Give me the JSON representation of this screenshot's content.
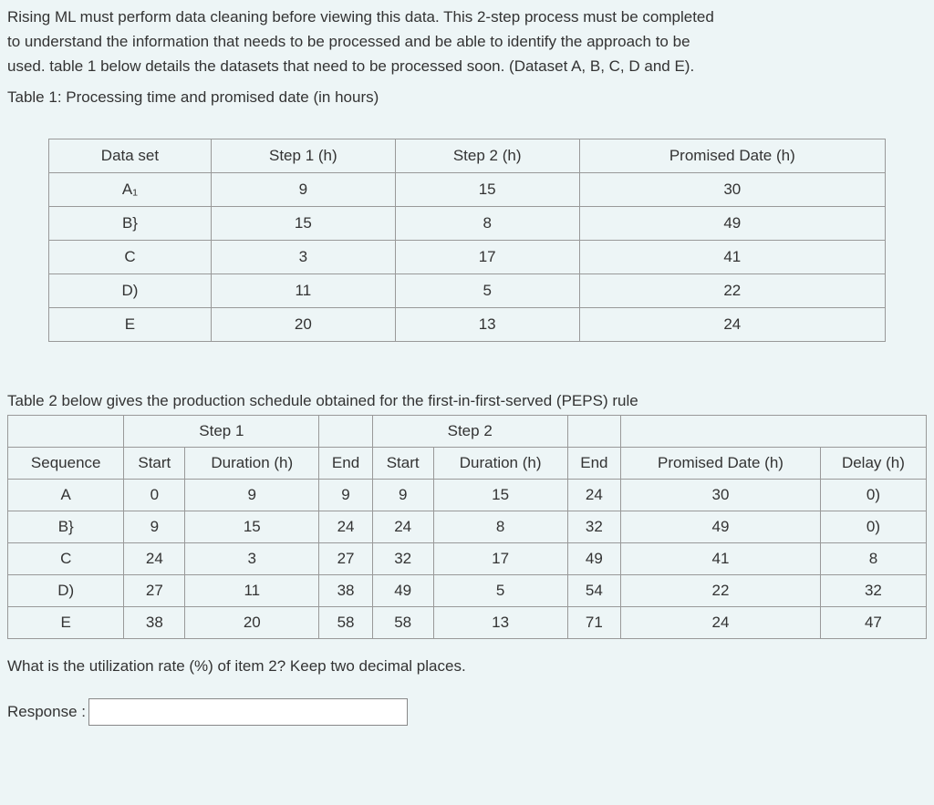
{
  "intro": {
    "line1": "Rising ML must perform data cleaning before viewing this data. This 2-step process must be completed",
    "line2": "to understand the information that needs to be processed and be able to identify the approach to be",
    "line3": "used. table 1 below details the datasets that need to be processed soon. (Dataset A, B, C, D and E)."
  },
  "table1": {
    "caption": "Table 1: Processing time and promised date (in hours)",
    "headers": {
      "c0": "Data set",
      "c1": "Step 1 (h)",
      "c2": "Step 2 (h)",
      "c3": "Promised Date (h)"
    },
    "rows": [
      {
        "c0": "A₁",
        "c1": "9",
        "c2": "15",
        "c3": "30"
      },
      {
        "c0": "B}",
        "c1": "15",
        "c2": "8",
        "c3": "49"
      },
      {
        "c0": "C",
        "c1": "3",
        "c2": "17",
        "c3": "41"
      },
      {
        "c0": "D)",
        "c1": "11",
        "c2": "5",
        "c3": "22"
      },
      {
        "c0": "E",
        "c1": "20",
        "c2": "13",
        "c3": "24"
      }
    ]
  },
  "table2": {
    "intro": "Table 2 below gives the production schedule obtained for the first-in-first-served (PEPS) rule",
    "groupHeaders": {
      "g0": "",
      "g1": "Step 1",
      "g2": "",
      "g3": "Step 2",
      "g4": "",
      "g5": ""
    },
    "headers": {
      "h0": "Sequence",
      "h1": "Start",
      "h2": "Duration (h)",
      "h3": "End",
      "h4": "Start",
      "h5": "Duration (h)",
      "h6": "End",
      "h7": "Promised Date (h)",
      "h8": "Delay (h)"
    },
    "rows": [
      {
        "c0": "A",
        "c1": "0",
        "c2": "9",
        "c3": "9",
        "c4": "9",
        "c5": "15",
        "c6": "24",
        "c7": "30",
        "c8": "0)"
      },
      {
        "c0": "B}",
        "c1": "9",
        "c2": "15",
        "c3": "24",
        "c4": "24",
        "c5": "8",
        "c6": "32",
        "c7": "49",
        "c8": "0)"
      },
      {
        "c0": "C",
        "c1": "24",
        "c2": "3",
        "c3": "27",
        "c4": "32",
        "c5": "17",
        "c6": "49",
        "c7": "41",
        "c8": "8"
      },
      {
        "c0": "D)",
        "c1": "27",
        "c2": "11",
        "c3": "38",
        "c4": "49",
        "c5": "5",
        "c6": "54",
        "c7": "22",
        "c8": "32"
      },
      {
        "c0": "E",
        "c1": "38",
        "c2": "20",
        "c3": "58",
        "c4": "58",
        "c5": "13",
        "c6": "71",
        "c7": "24",
        "c8": "47"
      }
    ]
  },
  "question": "What is the utilization rate (%) of item 2? Keep two decimal places.",
  "response": {
    "label": "Response :",
    "value": ""
  }
}
